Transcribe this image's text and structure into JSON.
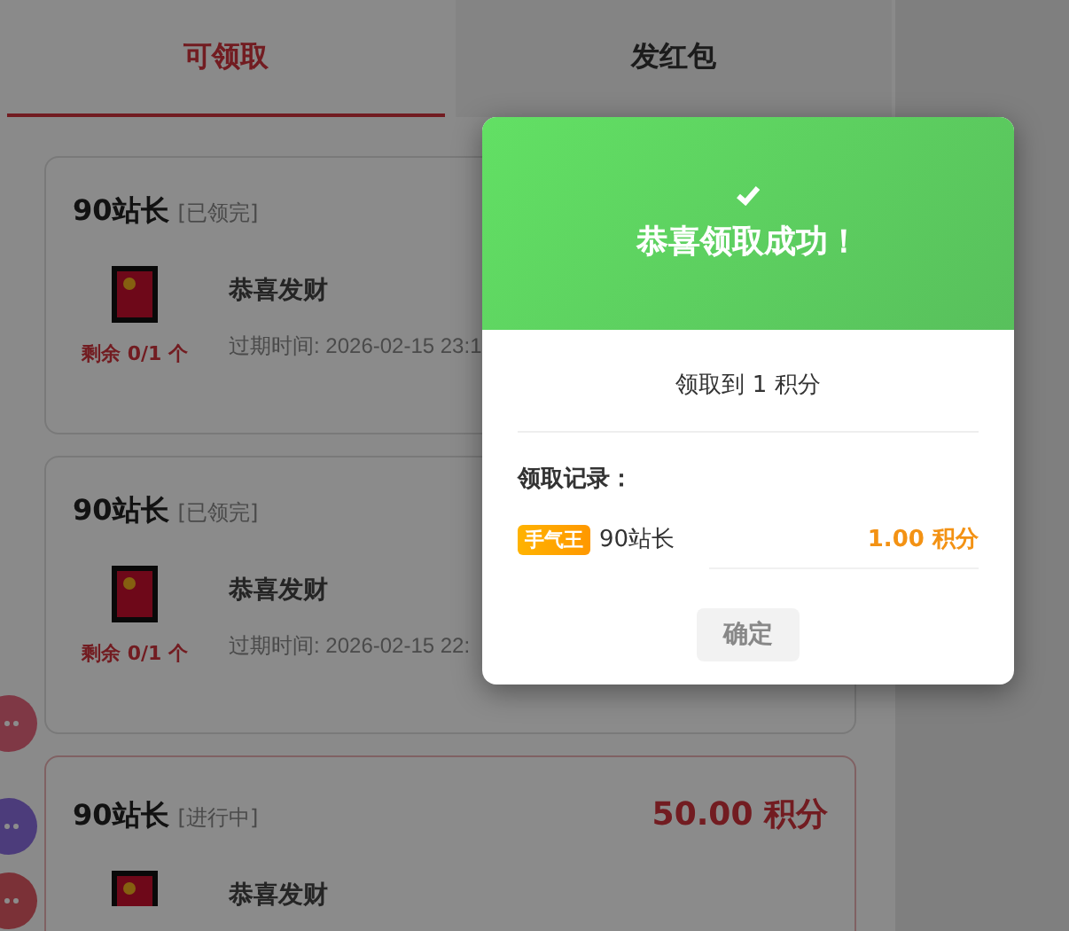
{
  "tabs": [
    {
      "label": "可领取",
      "selected": true
    },
    {
      "label": "发红包",
      "selected": false
    }
  ],
  "cards": [
    {
      "name": "90站长",
      "status": "[已领完]",
      "kind": "done",
      "title": "恭喜发财",
      "expiry": "过期时间: 2026-02-15 23:1",
      "remaining": "剩余 0/1 个"
    },
    {
      "name": "90站长",
      "status": "[已领完]",
      "kind": "done",
      "title": "恭喜发财",
      "expiry": "过期时间: 2026-02-15 22:",
      "remaining": "剩余 0/1 个"
    },
    {
      "name": "90站长",
      "status": "[进行中]",
      "kind": "active",
      "amount": "50.00 积分",
      "title": "恭喜发财"
    }
  ],
  "dialog": {
    "title": "恭喜领取成功！",
    "summary": "领取到 1 积分",
    "records_label": "领取记录：",
    "records": [
      {
        "badge": "手气王",
        "name": "90站长",
        "amount": "1.00 积分"
      }
    ],
    "button": "确定"
  }
}
